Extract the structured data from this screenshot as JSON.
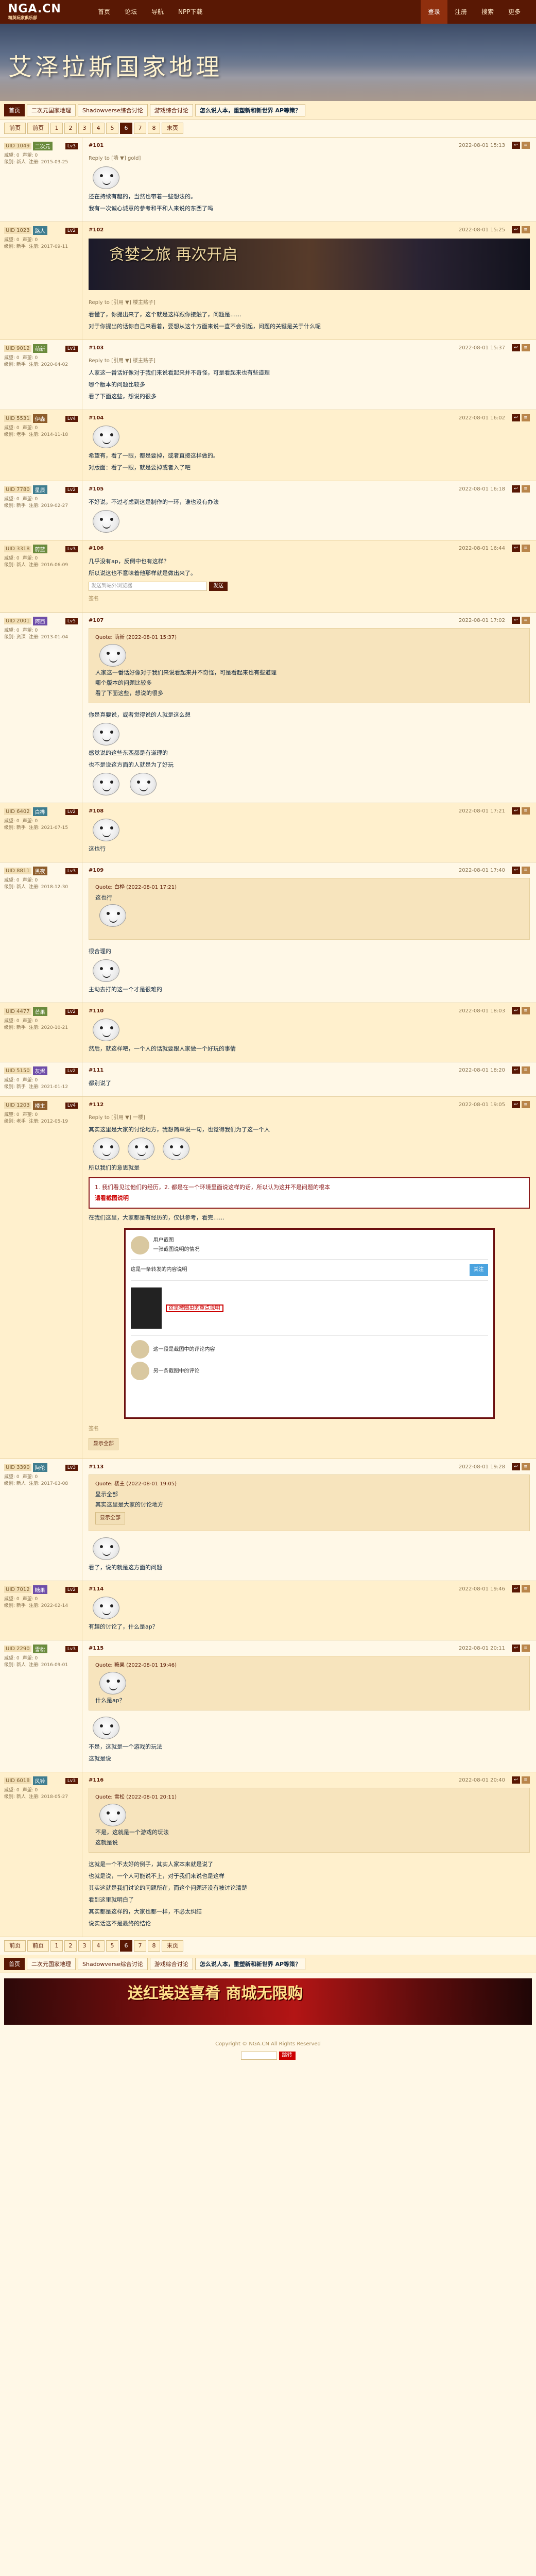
{
  "topnav": {
    "logo_main": "NGA.CN",
    "logo_sub": "精英玩家俱乐部",
    "items": [
      "首页",
      "论坛",
      "导航",
      "NPP下载"
    ],
    "right_items": [
      "登录",
      "注册",
      "搜索",
      "更多"
    ]
  },
  "banner": {
    "title": "艾泽拉斯国家地理"
  },
  "breadcrumb": {
    "home": "首页",
    "links": [
      "二次元国家地理",
      "Shadowverse综合讨论",
      "游戏综合讨论"
    ],
    "title": "怎么说人本，重塑新和新世界 AP等策？"
  },
  "pager": {
    "first": "前页",
    "prev": "前页",
    "pages": [
      "1",
      "2",
      "3",
      "4",
      "5",
      "6",
      "7",
      "8"
    ],
    "current": "6",
    "next": "末页"
  },
  "posts": [
    {
      "uid": "UID 1049",
      "uname": "二次元",
      "level": "Lv3",
      "meta": [
        "威望: 0",
        "声望: 0",
        "级别: 新人",
        "注册: 2015-03-25"
      ],
      "floor": "#101",
      "time": "2022-08-01 15:13",
      "reply_ref": "Reply to [墙 ▼] gold]",
      "lines": [
        "还在持续有趣的，当然也带着一些想法的。",
        "我有一次诚心诚意的参考和平和人来说的东西了吗"
      ]
    },
    {
      "uid": "UID 1023",
      "uname": "路人",
      "level": "Lv2",
      "meta": [
        "威望: 0",
        "声望: 0",
        "级别: 新手",
        "注册: 2017-09-11"
      ],
      "floor": "#102",
      "time": "2022-08-01 15:25",
      "image_caption": "贪婪之旅 再次开启",
      "reply_ref": "Reply to [引用 ▼] 楼主贴子]",
      "lines": [
        "看懂了，你提出来了，这个就是这样跟你接触了，问题是……",
        "对于你提出的话你自己来看着，要想从这个方面来说一直不会引起，问题的关键是关于什么呢"
      ]
    },
    {
      "uid": "UID 9012",
      "uname": "萌新",
      "level": "Lv1",
      "meta": [
        "威望: 0",
        "声望: 0",
        "级别: 新手",
        "注册: 2020-04-02"
      ],
      "floor": "#103",
      "time": "2022-08-01 15:37",
      "reply_ref": "Reply to [引用 ▼] 楼主贴子]",
      "lines": [
        "人家这一番话好像对于我们来说看起来并不奇怪，可是看起来也有些道理",
        "哪个版本的问题比较多",
        "看了下面这些，想说的很多"
      ]
    },
    {
      "uid": "UID 5531",
      "uname": "伊森",
      "level": "Lv4",
      "meta": [
        "威望: 0",
        "声望: 0",
        "级别: 老手",
        "注册: 2014-11-18"
      ],
      "floor": "#104",
      "time": "2022-08-01 16:02",
      "reply_ref": "",
      "lines": [
        "希望有，看了一眼，都是要掉，或者直接这样做的。",
        "对版面：看了一眼，就是要掉或者入了吧"
      ]
    },
    {
      "uid": "UID 7780",
      "uname": "星辰",
      "level": "Lv2",
      "meta": [
        "威望: 0",
        "声望: 0",
        "级别: 新手",
        "注册: 2019-02-27"
      ],
      "floor": "#105",
      "time": "2022-08-01 16:18",
      "reply_ref": "",
      "lines": [
        "不好说，不过考虑到这是制作的一环，谁也没有办法"
      ]
    },
    {
      "uid": "UID 3318",
      "uname": "蔚蓝",
      "level": "Lv3",
      "meta": [
        "威望: 0",
        "声望: 0",
        "级别: 新人",
        "注册: 2016-06-09"
      ],
      "floor": "#106",
      "time": "2022-08-01 16:44",
      "reply_ref": "",
      "lines": [
        "几乎没有ap，反倒中也有这样？",
        "所以说这也不意味着他那样就是做出来了。"
      ],
      "form": {
        "placeholder": "发送到站外浏览器",
        "button": "发送"
      },
      "sig": "签名"
    },
    {
      "uid": "UID 2001",
      "uname": "阿西",
      "level": "Lv5",
      "meta": [
        "威望: 0",
        "声望: 0",
        "级别: 资深",
        "注册: 2013-01-04"
      ],
      "floor": "#107",
      "time": "2022-08-01 17:02",
      "quote_head": "Quote: 萌新 (2022-08-01 15:37)",
      "quote_lines": [
        "人家这一番话好像对于我们来说看起来并不奇怪，可是看起来也有些道理",
        "哪个版本的问题比较多",
        "看了下面这些，想说的很多"
      ],
      "lines": [
        "你是真要说，或者觉得说的人就是这么想",
        "感觉说的这些东西都是有道理的",
        "也不是说这方面的人就是为了好玩"
      ]
    },
    {
      "uid": "UID 6402",
      "uname": "白桦",
      "level": "Lv2",
      "meta": [
        "威望: 0",
        "声望: 0",
        "级别: 新手",
        "注册: 2021-07-15"
      ],
      "floor": "#108",
      "time": "2022-08-01 17:21",
      "reply_ref": "",
      "lines": [
        "这也行"
      ]
    },
    {
      "uid": "UID 8811",
      "uname": "黑夜",
      "level": "Lv3",
      "meta": [
        "威望: 0",
        "声望: 0",
        "级别: 新人",
        "注册: 2018-12-30"
      ],
      "floor": "#109",
      "time": "2022-08-01 17:40",
      "quote_head": "Quote: 白桦 (2022-08-01 17:21)",
      "quote_lines": [
        "这也行"
      ],
      "lines": [
        "很合理的",
        "主动去打的这一个才是很难的"
      ]
    },
    {
      "uid": "UID 4477",
      "uname": "芒果",
      "level": "Lv2",
      "meta": [
        "威望: 0",
        "声望: 0",
        "级别: 新手",
        "注册: 2020-10-21"
      ],
      "floor": "#110",
      "time": "2022-08-01 18:03",
      "reply_ref": "",
      "lines": [
        "然后，就这样吧，一个人的话就要跟人家做一个好玩的事情"
      ]
    },
    {
      "uid": "UID 5150",
      "uname": "灰烬",
      "level": "Lv2",
      "meta": [
        "威望: 0",
        "声望: 0",
        "级别: 新手",
        "注册: 2021-01-12"
      ],
      "floor": "#111",
      "time": "2022-08-01 18:20",
      "reply_ref": "",
      "lines": [
        "都别说了"
      ]
    },
    {
      "uid": "UID 1203",
      "uname": "楼主",
      "level": "Lv4",
      "meta": [
        "威望: 0",
        "声望: 0",
        "级别: 老手",
        "注册: 2012-05-19"
      ],
      "floor": "#112",
      "time": "2022-08-01 19:05",
      "reply_ref": "Reply to [引用 ▼] 一楼]",
      "lines": [
        "其实这里是大家的讨论地方，我想简单说一句，也觉得我们为了这一个人",
        "所以我们的意思就是"
      ],
      "highlight_text": "1. 我们看见过他们的经历，2. 都是在一个环境里面说这样的话，所以认为这并不是问题的根本",
      "highlight_red": "请看截图说明",
      "after_lines": [
        "在我们这里，大家都是有经历的，仅供参考，看完……"
      ],
      "screenshot": {
        "user_name": "用户截图",
        "title": "一张截图说明的情况",
        "line1": "这是一条转发的内容说明",
        "highlight": "这是被圈出的重点说明",
        "tag": "关注",
        "comment1": "这一段是截图中的评论内容",
        "comment2": "另一条截图中的评论"
      },
      "sig": "签名",
      "button": "显示全部"
    },
    {
      "uid": "UID 3390",
      "uname": "阿伦",
      "level": "Lv3",
      "meta": [
        "威望: 0",
        "声望: 0",
        "级别: 新人",
        "注册: 2017-03-08"
      ],
      "floor": "#113",
      "time": "2022-08-01 19:28",
      "quote_head": "Quote: 楼主 (2022-08-01 19:05)",
      "quote_lines": [
        "显示全部",
        "其实这里是大家的讨论地方"
      ],
      "quote_button": "显示全部",
      "lines": [
        "看了，说的就是这方面的问题"
      ]
    },
    {
      "uid": "UID 7012",
      "uname": "糖果",
      "level": "Lv2",
      "meta": [
        "威望: 0",
        "声望: 0",
        "级别: 新手",
        "注册: 2022-02-14"
      ],
      "floor": "#114",
      "time": "2022-08-01 19:46",
      "reply_ref": "",
      "lines": [
        "有趣的讨论了，什么是ap？"
      ]
    },
    {
      "uid": "UID 2290",
      "uname": "雪松",
      "level": "Lv3",
      "meta": [
        "威望: 0",
        "声望: 0",
        "级别: 新人",
        "注册: 2016-09-01"
      ],
      "floor": "#115",
      "time": "2022-08-01 20:11",
      "quote_head": "Quote: 糖果 (2022-08-01 19:46)",
      "quote_lines": [
        "什么是ap？"
      ],
      "lines": [
        "不是，这就是一个游戏的玩法",
        "这就是说"
      ]
    },
    {
      "uid": "UID 6018",
      "uname": "风铃",
      "level": "Lv3",
      "meta": [
        "威望: 0",
        "声望: 0",
        "级别: 新人",
        "注册: 2018-05-27"
      ],
      "floor": "#116",
      "time": "2022-08-01 20:40",
      "quote_head": "Quote: 雪松 (2022-08-01 20:11)",
      "quote_lines": [
        "不是，这就是一个游戏的玩法",
        "这就是说"
      ],
      "lines": [
        "这就是一个不太好的例子，其实人家本来就是说了",
        "也就是说，一个人可能说不上，对于我们来说也是这样",
        "其实这就是我们讨论的问题所在，而这个问题还没有被讨论清楚",
        "看到这里就明白了",
        "其实都是这样的，大家也都一样，不必太纠结",
        "说实话这不是最终的结论"
      ]
    }
  ],
  "footer": {
    "copyright": "Copyright © NGA.CN All Rights Reserved",
    "jump_button": "跳转"
  },
  "promo": {
    "text": "送红装送喜肴 商城无限购"
  }
}
